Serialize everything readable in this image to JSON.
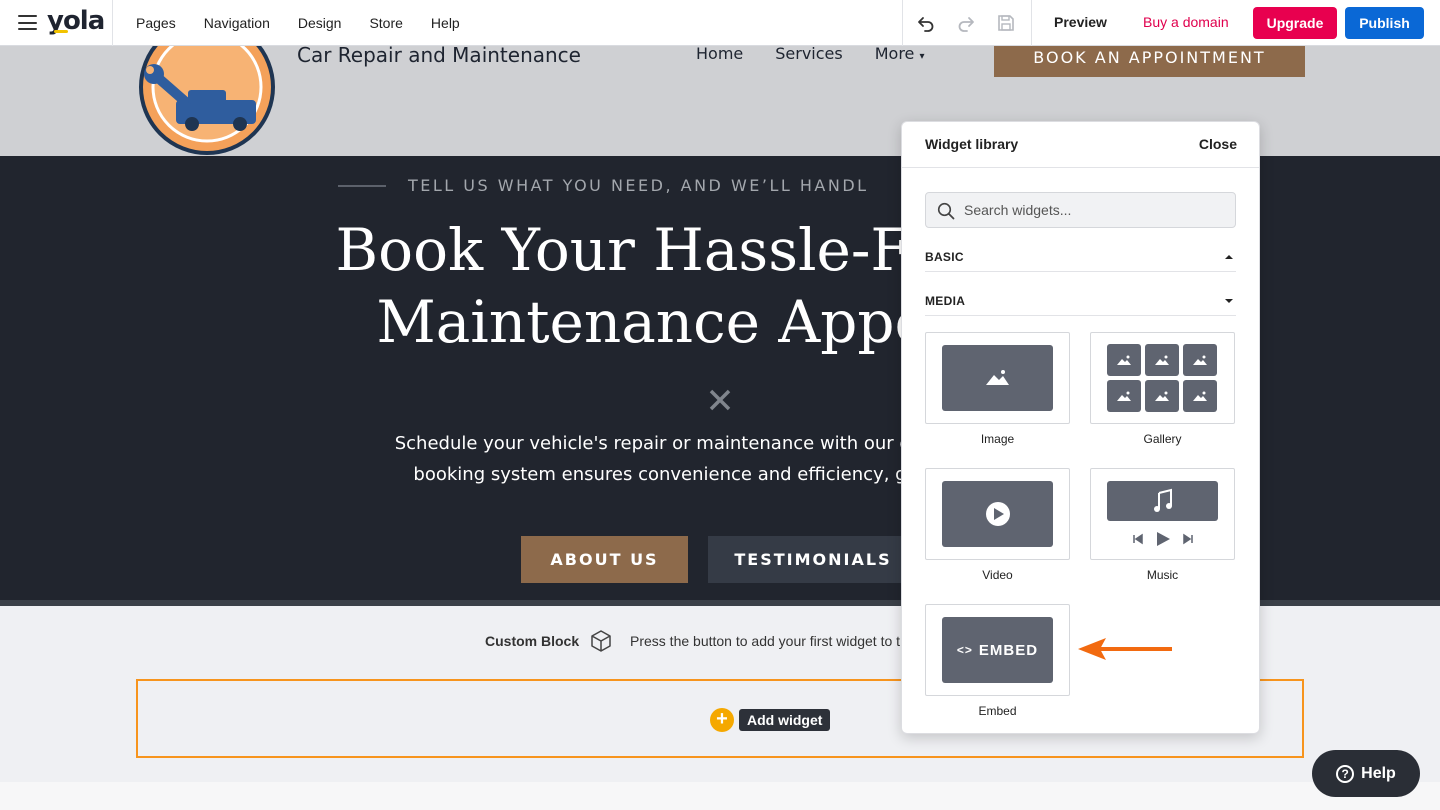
{
  "editor": {
    "logo": "yola",
    "nav": [
      "Pages",
      "Navigation",
      "Design",
      "Store",
      "Help"
    ],
    "preview": "Preview",
    "buy_domain": "Buy a domain",
    "upgrade": "Upgrade",
    "publish": "Publish",
    "colors": {
      "upgrade": "#e8004f",
      "publish": "#0a68d6",
      "domain": "#e0004d"
    }
  },
  "site": {
    "title": "Car Repair and Maintenance",
    "nav": [
      "Home",
      "Services",
      "More"
    ],
    "book_button": "BOOK AN APPOINTMENT",
    "hero": {
      "eyebrow": "TELL US WHAT YOU NEED, AND WE’LL HANDL",
      "title_line1": "Book Your Hassle-Free Ca",
      "title_line2": "Maintenance Appointm",
      "text_line1": "Schedule your vehicle's repair or maintenance with our expert technicia",
      "text_line2": "booking system ensures convenience and efficiency, getting you ba",
      "button_about": "ABOUT US",
      "button_testimonials": "TESTIMONIALS"
    }
  },
  "custom_block": {
    "label": "Custom Block",
    "hint": "Press the button to add your first widget to t",
    "add_widget": "Add widget"
  },
  "widget_library": {
    "title": "Widget library",
    "close": "Close",
    "search_placeholder": "Search widgets...",
    "sections": [
      {
        "label": "BASIC",
        "expanded": false
      },
      {
        "label": "MEDIA",
        "expanded": true
      }
    ],
    "widgets": [
      "Image",
      "Gallery",
      "Video",
      "Music",
      "Embed"
    ],
    "embed_preview_text": "EMBED"
  },
  "help": {
    "label": "Help"
  }
}
